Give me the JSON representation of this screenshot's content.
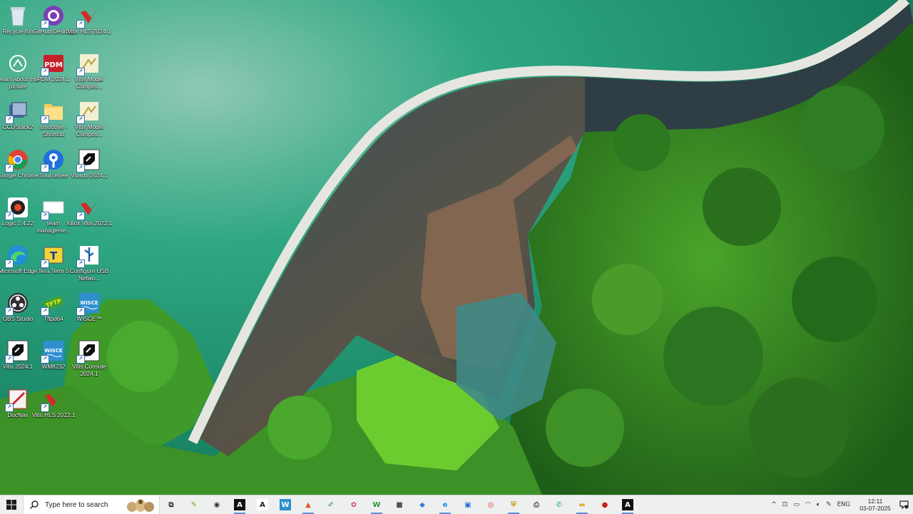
{
  "desktop": {
    "icons": [
      {
        "label": "Recycle Bin",
        "icon": "recycle-bin-icon"
      },
      {
        "label": "GitHub Desktop",
        "icon": "github-desktop-icon"
      },
      {
        "label": "Vitis HLS 2024.1",
        "icon": "vitis-hls-icon"
      },
      {
        "label": "Learn about this picture",
        "icon": "learn-picture-icon"
      },
      {
        "label": "PDM 2024.1",
        "icon": "pdm-icon",
        "badge": "PDM"
      },
      {
        "label": "Vitis Model Compos...",
        "icon": "vitis-model-composer-icon"
      },
      {
        "label": "CCDStack2",
        "icon": "ccdstack-icon"
      },
      {
        "label": "smoothie - Shortcut",
        "icon": "folder-shortcut-icon"
      },
      {
        "label": "Vitis Model Compos...",
        "icon": "vitis-model-composer-icon"
      },
      {
        "label": "Google Chrome",
        "icon": "chrome-icon"
      },
      {
        "label": "Sourcetree",
        "icon": "sourcetree-icon"
      },
      {
        "label": "Vivado 2024.1",
        "icon": "vivado-icon"
      },
      {
        "label": "Logic 2.4.22",
        "icon": "logic-icon"
      },
      {
        "label": "team manageme...",
        "icon": "document-icon"
      },
      {
        "label": "Xilinx Vitis 2022.1",
        "icon": "xilinx-vitis-icon"
      },
      {
        "label": "Microsoft Edge",
        "icon": "edge-icon"
      },
      {
        "label": "Tera Term 5",
        "icon": "teraterm-icon",
        "badge": "T"
      },
      {
        "label": "Configure USB Netwo...",
        "icon": "usb-icon"
      },
      {
        "label": "OBS Studio",
        "icon": "obs-icon"
      },
      {
        "label": "Tftpd64",
        "icon": "tftpd-icon",
        "badge": "TFTP"
      },
      {
        "label": "WISCE™",
        "icon": "wisce-icon",
        "badge": "WISCE"
      },
      {
        "label": "Vitis 2024.1",
        "icon": "vitis-icon"
      },
      {
        "label": "WM8232",
        "icon": "wisce-icon",
        "badge": "WISCE"
      },
      {
        "label": "Vitis Console 2024.1",
        "icon": "vitis-console-icon"
      },
      {
        "label": "DocNav",
        "icon": "docnav-icon"
      },
      {
        "label": "Vitis HLS 2022.1",
        "icon": "vitis-hls-icon"
      }
    ]
  },
  "taskbar": {
    "search_placeholder": "Type here to search",
    "apps": [
      {
        "name": "task-view",
        "icon": "task-view-icon",
        "glyph": "⧉"
      },
      {
        "name": "notepad-pp",
        "icon": "pen-icon",
        "glyph": "✎"
      },
      {
        "name": "obs",
        "icon": "obs-icon",
        "glyph": "◉"
      },
      {
        "name": "vivado",
        "icon": "vivado-icon",
        "glyph": "A"
      },
      {
        "name": "vitis-model",
        "icon": "vitis-model-composer-icon",
        "glyph": "A"
      },
      {
        "name": "wisce",
        "icon": "wisce-icon",
        "glyph": "W"
      },
      {
        "name": "matlab",
        "icon": "matlab-icon",
        "glyph": "▲"
      },
      {
        "name": "notepad",
        "icon": "notepad-icon",
        "glyph": "✐"
      },
      {
        "name": "paint",
        "icon": "paint-icon",
        "glyph": "✿"
      },
      {
        "name": "wm",
        "icon": "w-app-icon",
        "glyph": "W"
      },
      {
        "name": "terminal",
        "icon": "terminal-icon",
        "glyph": "■"
      },
      {
        "name": "files",
        "icon": "files-icon",
        "glyph": "◆"
      },
      {
        "name": "edge",
        "icon": "edge-icon",
        "glyph": "e"
      },
      {
        "name": "outlook",
        "icon": "outlook-icon",
        "glyph": "▣"
      },
      {
        "name": "chrome",
        "icon": "chrome-icon",
        "glyph": "◎"
      },
      {
        "name": "shield",
        "icon": "shield-icon",
        "glyph": "⛨"
      },
      {
        "name": "printer",
        "icon": "printer-icon",
        "glyph": "⎙"
      },
      {
        "name": "whatsapp",
        "icon": "whatsapp-icon",
        "glyph": "✆"
      },
      {
        "name": "file-explorer",
        "icon": "folder-icon",
        "glyph": "▬"
      },
      {
        "name": "red-app",
        "icon": "red-app-icon",
        "glyph": "●"
      },
      {
        "name": "vitis-active",
        "icon": "vitis-icon",
        "glyph": "A"
      }
    ],
    "tray": {
      "chevron": "^",
      "language": "ENG",
      "time": "12:11",
      "date": "03-07-2025"
    }
  },
  "colors": {
    "taskbar_bg": "#eef0f0",
    "accent": "#5b8dd6",
    "lake": "#1e8a66"
  }
}
